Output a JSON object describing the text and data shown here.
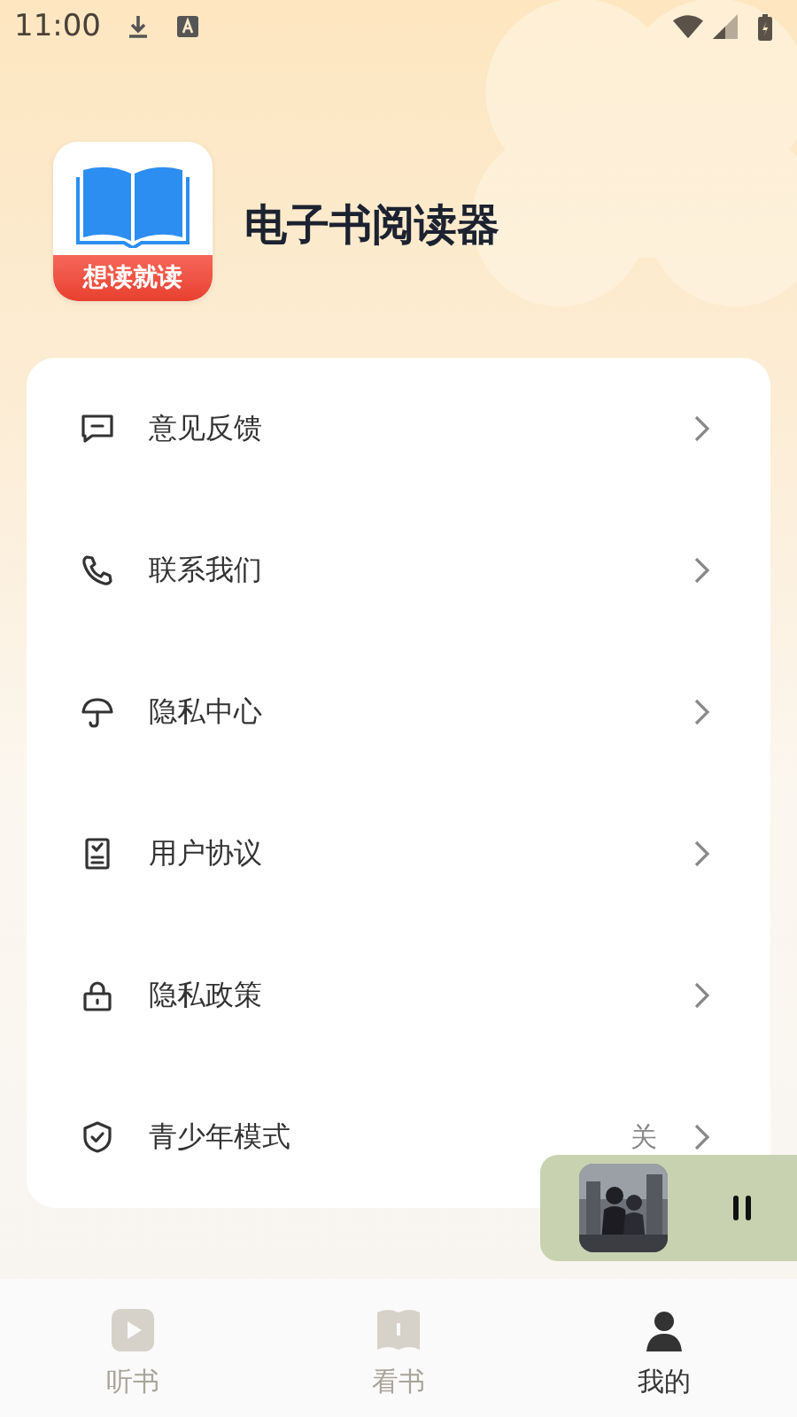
{
  "status_bar": {
    "time": "11:00"
  },
  "app": {
    "logo_caption": "想读就读",
    "name": "电子书阅读器"
  },
  "menu": [
    {
      "label": "意见反馈"
    },
    {
      "label": "联系我们"
    },
    {
      "label": "隐私中心"
    },
    {
      "label": "用户协议"
    },
    {
      "label": "隐私政策"
    },
    {
      "label": "青少年模式",
      "value": "关"
    }
  ],
  "player": {
    "playing": true
  },
  "tabs": [
    {
      "label": "听书",
      "selected": false
    },
    {
      "label": "看书",
      "selected": false
    },
    {
      "label": "我的",
      "selected": true
    }
  ]
}
